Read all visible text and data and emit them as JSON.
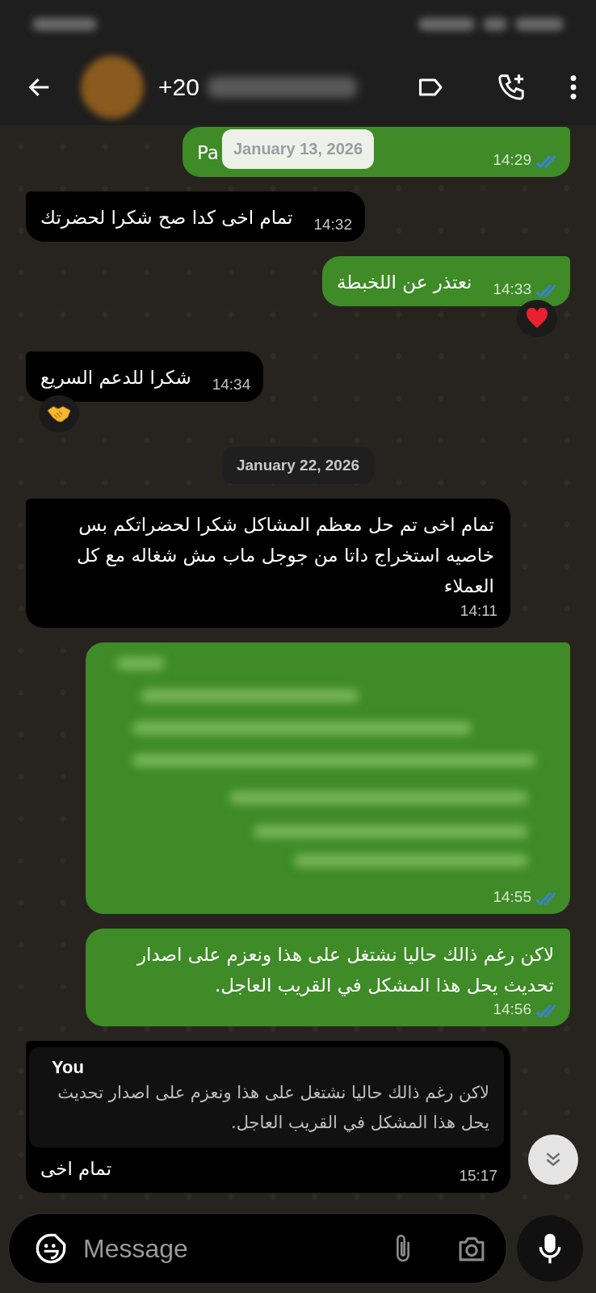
{
  "header": {
    "contact": "+20"
  },
  "overlay_date": "January 13, 2026",
  "messages": [
    {
      "kind": "text",
      "outgoing": true,
      "text": "Pa",
      "time": "14:29",
      "read": true
    },
    {
      "kind": "text",
      "outgoing": false,
      "text": "تمام اخى كدا صح شكرا لحضرتك",
      "time": "14:32"
    },
    {
      "kind": "text",
      "outgoing": true,
      "text": "نعتذر عن اللخبطة",
      "time": "14:33",
      "read": true,
      "reaction": {
        "kind": "heart"
      }
    },
    {
      "kind": "text",
      "outgoing": false,
      "text": "شكرا للدعم السريع",
      "time": "14:34",
      "reaction": {
        "kind": "handshake"
      }
    },
    {
      "kind": "date",
      "text": "January 22, 2026"
    },
    {
      "kind": "text",
      "outgoing": false,
      "text": "تمام اخى تم حل معظم المشاكل شكرا لحضراتكم بس خاصيه استخراج داتا من جوجل ماب مش شغاله مع كل العملاء",
      "time": "14:11"
    },
    {
      "kind": "blurred",
      "outgoing": true,
      "time": "14:55",
      "read": true
    },
    {
      "kind": "text",
      "outgoing": true,
      "text": "لاكن رغم ذالك حاليا نشتغل على هذا  ونعزم على اصدار تحديث يحل هذا المشكل في القريب العاجل.",
      "time": "14:56",
      "read": true
    },
    {
      "kind": "reply",
      "outgoing": false,
      "quote": {
        "author": "You",
        "text": "لاكن رغم ذالك حاليا نشتغل على هذا  ونعزم على اصدار تحديث يحل هذا المشكل في القريب العاجل."
      },
      "text": "تمام اخى",
      "time": "15:17"
    }
  ],
  "composer": {
    "placeholder": "Message"
  }
}
